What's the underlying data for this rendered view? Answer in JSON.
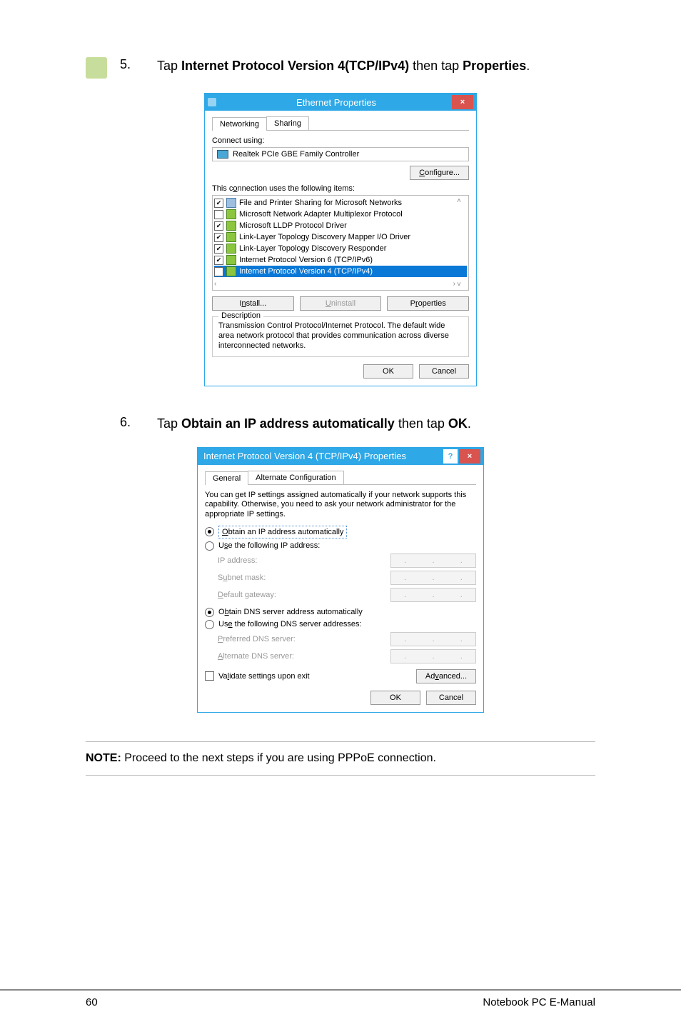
{
  "step5": {
    "num": "5.",
    "prefix": "Tap ",
    "bold1": "Internet Protocol Version 4(TCP/IPv4)",
    "mid": " then tap ",
    "bold2": "Properties",
    "suffix": "."
  },
  "dialog1": {
    "title": "Ethernet Properties",
    "close": "×",
    "tabs": {
      "networking": "Networking",
      "sharing": "Sharing"
    },
    "connect_label": "Connect using:",
    "adapter": "Realtek PCIe GBE Family Controller",
    "configure": "Configure...",
    "list_label": "This connection uses the following items:",
    "items": [
      {
        "checked": true,
        "label": "File and Printer Sharing for Microsoft Networks"
      },
      {
        "checked": false,
        "label": "Microsoft Network Adapter Multiplexor Protocol"
      },
      {
        "checked": true,
        "label": "Microsoft LLDP Protocol Driver"
      },
      {
        "checked": true,
        "label": "Link-Layer Topology Discovery Mapper I/O Driver"
      },
      {
        "checked": true,
        "label": "Link-Layer Topology Discovery Responder"
      },
      {
        "checked": true,
        "label": "Internet Protocol Version 6 (TCP/IPv6)"
      },
      {
        "checked": true,
        "label": "Internet Protocol Version 4 (TCP/IPv4)",
        "selected": true
      }
    ],
    "install": "Install...",
    "uninstall": "Uninstall",
    "properties": "Properties",
    "desc_title": "Description",
    "desc_text": "Transmission Control Protocol/Internet Protocol. The default wide area network protocol that provides communication across diverse interconnected networks.",
    "ok": "OK",
    "cancel": "Cancel"
  },
  "step6": {
    "num": "6.",
    "prefix": "Tap ",
    "bold1": "Obtain an IP address automatically",
    "mid": " then tap ",
    "bold2": "OK",
    "suffix": "."
  },
  "dialog2": {
    "title": "Internet Protocol Version 4 (TCP/IPv4) Properties",
    "help": "?",
    "close": "×",
    "tabs": {
      "general": "General",
      "alt": "Alternate Configuration"
    },
    "intro": "You can get IP settings assigned automatically if your network supports this capability. Otherwise, you need to ask your network administrator for the appropriate IP settings.",
    "r_obtain_ip": "Obtain an IP address automatically",
    "r_use_ip": "Use the following IP address:",
    "ip_address": "IP address:",
    "subnet": "Subnet mask:",
    "gateway": "Default gateway:",
    "r_obtain_dns": "Obtain DNS server address automatically",
    "r_use_dns": "Use the following DNS server addresses:",
    "pref_dns": "Preferred DNS server:",
    "alt_dns": "Alternate DNS server:",
    "validate": "Validate settings upon exit",
    "advanced": "Advanced...",
    "ok": "OK",
    "cancel": "Cancel"
  },
  "note": {
    "bold": "NOTE:",
    "text": " Proceed to the next steps if you are using PPPoE connection."
  },
  "footer": {
    "page": "60",
    "doc": "Notebook PC E-Manual"
  }
}
